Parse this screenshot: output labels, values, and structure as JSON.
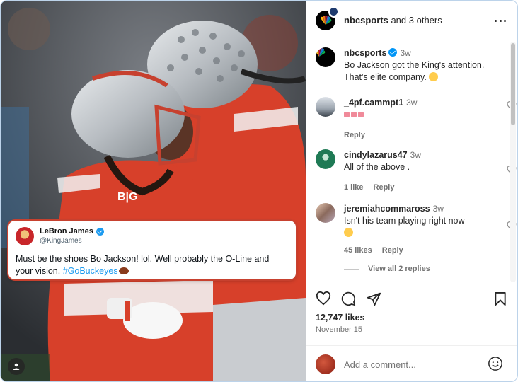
{
  "tweet": {
    "name": "LeBron James",
    "handle": "@KingJames",
    "text": "Must be the shoes Bo Jackson! lol. Well probably the O-Line and your vision. ",
    "hashtag": "#GoBuckeyes"
  },
  "header": {
    "owner": "nbcsports",
    "others": " and 3 others"
  },
  "caption": {
    "user": "nbcsports",
    "time": "3w",
    "text": "Bo Jackson got the King's attention. That's elite company."
  },
  "comments": [
    {
      "user": "_4pf.cammpt1",
      "time": "3w",
      "text": "",
      "likes": "",
      "reply": "Reply"
    },
    {
      "user": "cindylazarus47",
      "time": "3w",
      "text": "All of the above .",
      "likes": "1 like",
      "reply": "Reply"
    },
    {
      "user": "jeremiahcommaross",
      "time": "3w",
      "text": "Isn't his team playing right now",
      "likes": "45 likes",
      "reply": "Reply"
    }
  ],
  "view_replies": "View all 2 replies",
  "post": {
    "likes": "12,747 likes",
    "date": "November 15"
  },
  "comment_box": {
    "placeholder": "Add a comment..."
  },
  "colors": {
    "verified": "#0095f6",
    "hashtag": "#1d9bf0",
    "jersey": "#d7402a",
    "helmet": "#c9cdd1"
  },
  "icons": [
    "heart-icon",
    "comment-icon",
    "share-icon",
    "bookmark-icon",
    "more-icon",
    "emoji-icon",
    "user-tag-icon"
  ]
}
